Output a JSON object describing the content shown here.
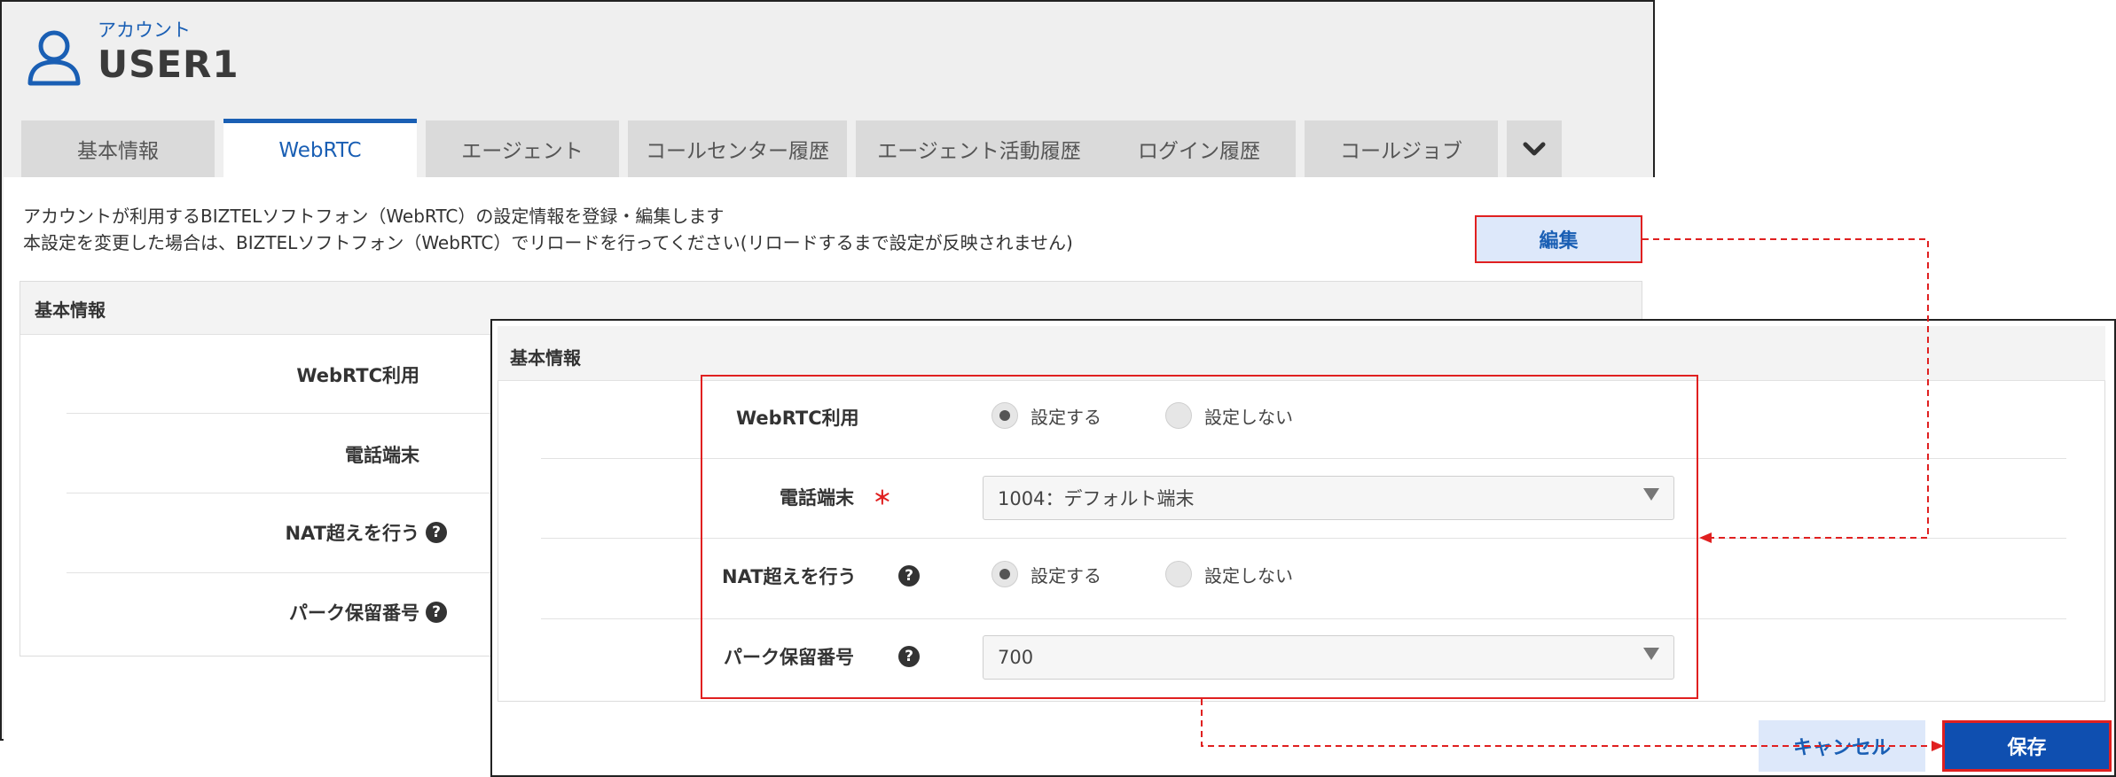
{
  "account": {
    "label": "アカウント",
    "name": "USER1"
  },
  "tabs": [
    {
      "label": "基本情報",
      "active": false
    },
    {
      "label": "WebRTC",
      "active": true
    },
    {
      "label": "エージェント",
      "active": false
    },
    {
      "label": "コールセンター履歴",
      "active": false
    },
    {
      "label": "エージェント活動履歴",
      "active": false
    },
    {
      "label": "ログイン履歴",
      "active": false
    },
    {
      "label": "コールジョブ",
      "active": false
    }
  ],
  "description": {
    "line1": "アカウントが利用するBIZTELソフトフォン（WebRTC）の設定情報を登録・編集します",
    "line2": "本設定を変更した場合は、BIZTELソフトフォン（WebRTC）でリロードを行ってください(リロードするまで設定が反映されません)"
  },
  "edit_label": "編集",
  "panel_title": "基本情報",
  "fields": {
    "webrtc_use": "WebRTC利用",
    "phone_device": "電話端末",
    "nat_traversal": "NAT超えを行う",
    "park_hold_number": "パーク保留番号"
  },
  "required_mark": "＊",
  "help_glyph": "?",
  "options": {
    "enable": "設定する",
    "disable": "設定しない"
  },
  "form": {
    "webrtc_use_selected": "enable",
    "phone_device_value": "1004：デフォルト端末",
    "nat_traversal_selected": "enable",
    "park_hold_number_value": "700"
  },
  "buttons": {
    "cancel": "キャンセル",
    "save": "保存"
  },
  "colors": {
    "accent": "#1a5fb4",
    "highlight": "#e02020",
    "save_bg": "#0f4fb0",
    "light_button_bg": "#dde8fa"
  }
}
